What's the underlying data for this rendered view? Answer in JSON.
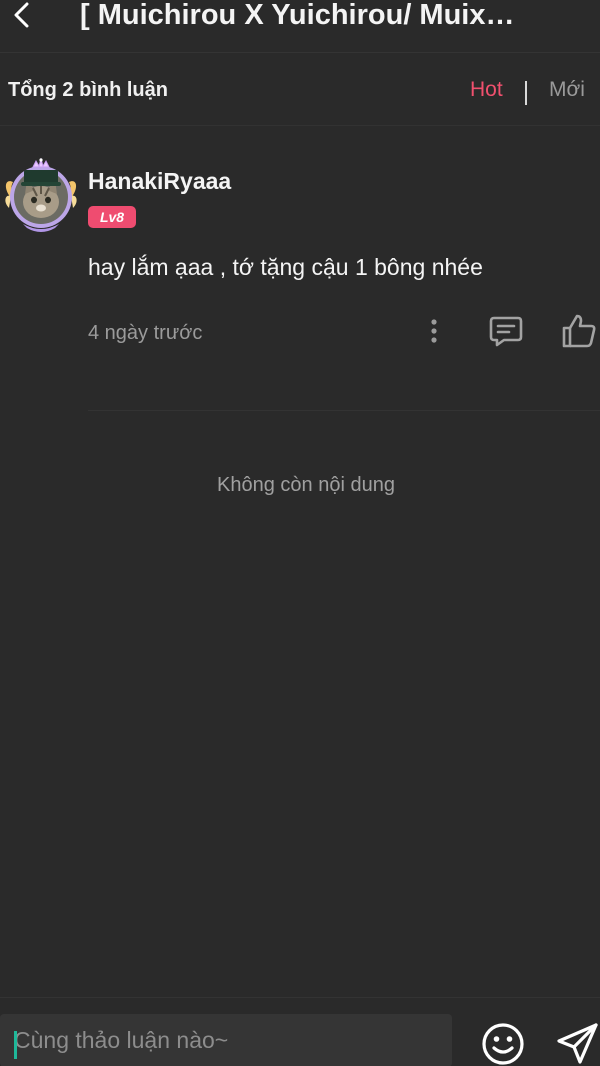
{
  "header": {
    "title": "[ Muichirou X Yuichirou/ Muix…",
    "back_icon": "chevron-left-icon"
  },
  "comments_header": {
    "total_label": "Tổng 2 bình luận",
    "sort_hot": "Hot",
    "sort_new": "Mới",
    "active_sort_color": "#f0506e"
  },
  "comment": {
    "username": "HanakiRyaaa",
    "level": "Lv8",
    "text": "hay lắm ạaa , tớ tặng cậu 1 bông nhée",
    "time": "4 ngày trước",
    "avatar_icon": "cat-avatar-with-frame",
    "level_badge_color": "#ef4c70"
  },
  "end_message": "Không còn nội dung",
  "composer": {
    "placeholder": "Cùng thảo luận nào~",
    "emoji_icon": "smiley-icon",
    "send_icon": "paper-plane-icon"
  }
}
